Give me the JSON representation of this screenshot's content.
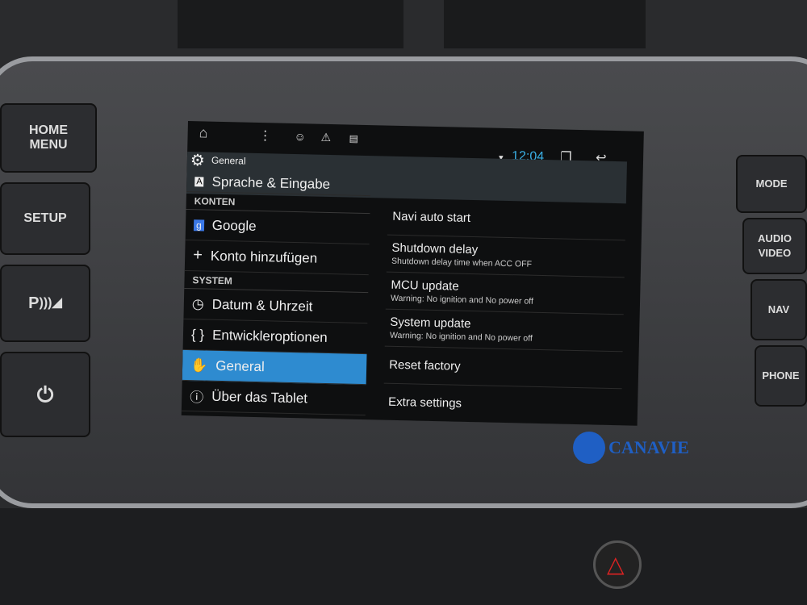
{
  "hardware": {
    "left_buttons": [
      {
        "label": "HOME MENU",
        "icon": ""
      },
      {
        "label": "SETUP",
        "icon": ""
      },
      {
        "label": "P",
        "icon": "parking-sensor-icon"
      },
      {
        "label": "",
        "icon": "power-icon"
      }
    ],
    "right_buttons": [
      {
        "label": "MODE"
      },
      {
        "label": "AUDIO VIDEO"
      },
      {
        "label": "NAV"
      },
      {
        "label": "PHONE"
      }
    ]
  },
  "status_bar": {
    "time": "12:04",
    "icons": [
      "home-icon",
      "menu-dots-icon",
      "waze-icon",
      "warning-icon",
      "sd-card-icon",
      "wifi-icon",
      "recent-apps-icon",
      "back-icon"
    ],
    "accent": "#3ab0e6"
  },
  "action_bar": {
    "title": "General",
    "icon": "gear-icon"
  },
  "sidebar": {
    "top_item": {
      "label": "Sprache & Eingabe",
      "icon": "language-icon"
    },
    "sections": [
      {
        "header": "KONTEN",
        "items": [
          {
            "label": "Google",
            "icon": "google-icon"
          },
          {
            "label": "Konto hinzufügen",
            "icon": "plus-icon"
          }
        ]
      },
      {
        "header": "SYSTEM",
        "items": [
          {
            "label": "Datum & Uhrzeit",
            "icon": "clock-icon"
          },
          {
            "label": "Entwickleroptionen",
            "icon": "braces-icon"
          },
          {
            "label": "General",
            "icon": "hand-icon",
            "selected": true
          },
          {
            "label": "Über das Tablet",
            "icon": "info-icon"
          }
        ]
      }
    ],
    "selected_color": "#2e8bd0"
  },
  "settings": [
    {
      "title": "Navi auto start",
      "summary": ""
    },
    {
      "title": "Shutdown delay",
      "summary": "Shutdown delay time when ACC OFF"
    },
    {
      "title": "MCU update",
      "summary": "Warning: No ignition and No power off"
    },
    {
      "title": "System update",
      "summary": "Warning: No ignition and No power off"
    },
    {
      "title": "Reset factory",
      "summary": ""
    },
    {
      "title": "Extra settings",
      "summary": ""
    }
  ],
  "watermark": "CANAVIE"
}
